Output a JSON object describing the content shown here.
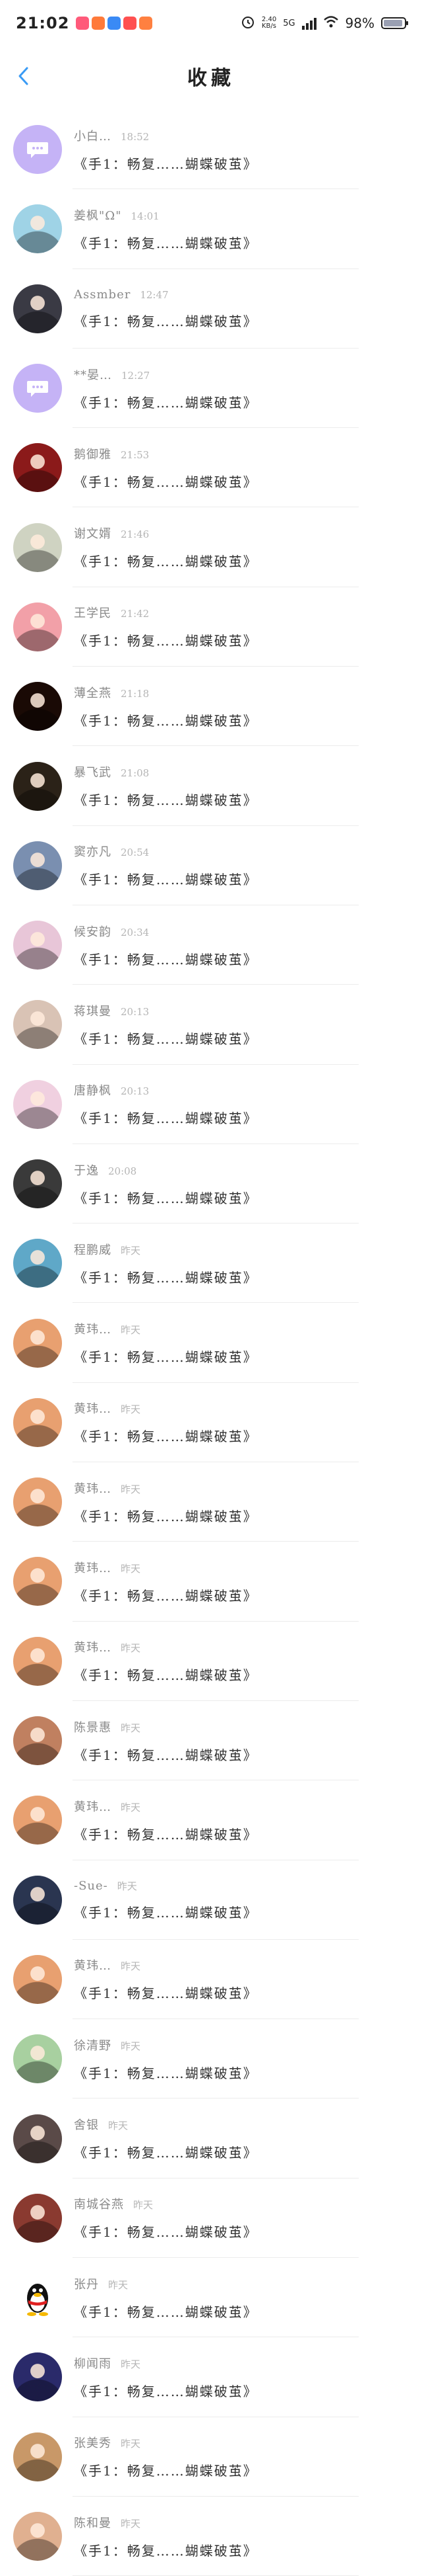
{
  "status_bar": {
    "time": "21:02",
    "network_speed": "2.40\nKB/s",
    "network_type": "5G",
    "battery": "98%"
  },
  "header": {
    "title": "收藏",
    "back_icon": "chevron-left-icon"
  },
  "colors": {
    "accent": "#3a9bf5",
    "avatar_default": "#c5b3f6"
  },
  "messages": [
    {
      "name": "小白…",
      "time": "18:52",
      "content": "《手1：畅复……蝴蝶破茧》",
      "avatar": "chat-bubble-icon",
      "avatar_color": "#c5b3f6"
    },
    {
      "name": "姜枫\"Ω\"",
      "time": "14:01",
      "content": "《手1：畅复……蝴蝶破茧》",
      "avatar": "photo",
      "avatar_color": "#9fd3e6"
    },
    {
      "name": "Assmber",
      "time": "12:47",
      "content": "《手1：畅复……蝴蝶破茧》",
      "avatar": "photo",
      "avatar_color": "#3a3a44"
    },
    {
      "name": "**晏…",
      "time": "12:27",
      "content": "《手1：畅复……蝴蝶破茧》",
      "avatar": "chat-bubble-icon",
      "avatar_color": "#c5b3f6"
    },
    {
      "name": "鹅御雅",
      "time": "21:53",
      "content": "《手1：畅复……蝴蝶破茧》",
      "avatar": "photo",
      "avatar_color": "#8b1a1a"
    },
    {
      "name": "谢文婿",
      "time": "21:46",
      "content": "《手1：畅复……蝴蝶破茧》",
      "avatar": "photo",
      "avatar_color": "#cfd3c2"
    },
    {
      "name": "王学民",
      "time": "21:42",
      "content": "《手1：畅复……蝴蝶破茧》",
      "avatar": "photo",
      "avatar_color": "#f2a0a8"
    },
    {
      "name": "薄全燕",
      "time": "21:18",
      "content": "《手1：畅复……蝴蝶破茧》",
      "avatar": "photo",
      "avatar_color": "#1a0a05"
    },
    {
      "name": "暴飞武",
      "time": "21:08",
      "content": "《手1：畅复……蝴蝶破茧》",
      "avatar": "photo",
      "avatar_color": "#2b2218"
    },
    {
      "name": "窦亦凡",
      "time": "20:54",
      "content": "《手1：畅复……蝴蝶破茧》",
      "avatar": "photo",
      "avatar_color": "#7a8fb0"
    },
    {
      "name": "候安韵",
      "time": "20:34",
      "content": "《手1：畅复……蝴蝶破茧》",
      "avatar": "photo",
      "avatar_color": "#e8c6d8"
    },
    {
      "name": "蒋琪曼",
      "time": "20:13",
      "content": "《手1：畅复……蝴蝶破茧》",
      "avatar": "photo",
      "avatar_color": "#d9c3b5"
    },
    {
      "name": "唐静枫",
      "time": "20:13",
      "content": "《手1：畅复……蝴蝶破茧》",
      "avatar": "photo",
      "avatar_color": "#f0d0e0"
    },
    {
      "name": "于逸",
      "time": "20:08",
      "content": "《手1：畅复……蝴蝶破茧》",
      "avatar": "photo",
      "avatar_color": "#3a3a3a"
    },
    {
      "name": "程鹏威",
      "time": "昨天",
      "content": "《手1：畅复……蝴蝶破茧》",
      "avatar": "photo",
      "avatar_color": "#5fa8c8"
    },
    {
      "name": "黄玮…",
      "time": "昨天",
      "content": "《手1：畅复……蝴蝶破茧》",
      "avatar": "photo",
      "avatar_color": "#e8a070"
    },
    {
      "name": "黄玮…",
      "time": "昨天",
      "content": "《手1：畅复……蝴蝶破茧》",
      "avatar": "photo",
      "avatar_color": "#e8a070"
    },
    {
      "name": "黄玮…",
      "time": "昨天",
      "content": "《手1：畅复……蝴蝶破茧》",
      "avatar": "photo",
      "avatar_color": "#e8a070"
    },
    {
      "name": "黄玮…",
      "time": "昨天",
      "content": "《手1：畅复……蝴蝶破茧》",
      "avatar": "photo",
      "avatar_color": "#e8a070"
    },
    {
      "name": "黄玮…",
      "time": "昨天",
      "content": "《手1：畅复……蝴蝶破茧》",
      "avatar": "photo",
      "avatar_color": "#e8a070"
    },
    {
      "name": "陈景惠",
      "time": "昨天",
      "content": "《手1：畅复……蝴蝶破茧》",
      "avatar": "photo",
      "avatar_color": "#c08060"
    },
    {
      "name": "黄玮…",
      "time": "昨天",
      "content": "《手1：畅复……蝴蝶破茧》",
      "avatar": "photo",
      "avatar_color": "#e8a070"
    },
    {
      "name": "-Sue-",
      "time": "昨天",
      "content": "《手1：畅复……蝴蝶破茧》",
      "avatar": "photo",
      "avatar_color": "#2a3550"
    },
    {
      "name": "黄玮…",
      "time": "昨天",
      "content": "《手1：畅复……蝴蝶破茧》",
      "avatar": "photo",
      "avatar_color": "#e8a070"
    },
    {
      "name": "徐清野",
      "time": "昨天",
      "content": "《手1：畅复……蝴蝶破茧》",
      "avatar": "photo",
      "avatar_color": "#a8d0a0"
    },
    {
      "name": "舍银",
      "time": "昨天",
      "content": "《手1：畅复……蝴蝶破茧》",
      "avatar": "photo",
      "avatar_color": "#5a4a48"
    },
    {
      "name": "南城谷燕",
      "time": "昨天",
      "content": "《手1：畅复……蝴蝶破茧》",
      "avatar": "photo",
      "avatar_color": "#8a3a30"
    },
    {
      "name": "张丹",
      "time": "昨天",
      "content": "《手1：畅复……蝴蝶破茧》",
      "avatar": "qq-penguin-icon",
      "avatar_color": "#ffffff"
    },
    {
      "name": "柳闻雨",
      "time": "昨天",
      "content": "《手1：畅复……蝴蝶破茧》",
      "avatar": "photo",
      "avatar_color": "#2a2a6a"
    },
    {
      "name": "张美秀",
      "time": "昨天",
      "content": "《手1：畅复……蝴蝶破茧》",
      "avatar": "photo",
      "avatar_color": "#c89868"
    },
    {
      "name": "陈和曼",
      "time": "昨天",
      "content": "《手1：畅复……蝴蝶破茧》",
      "avatar": "photo",
      "avatar_color": "#e0b090"
    }
  ]
}
